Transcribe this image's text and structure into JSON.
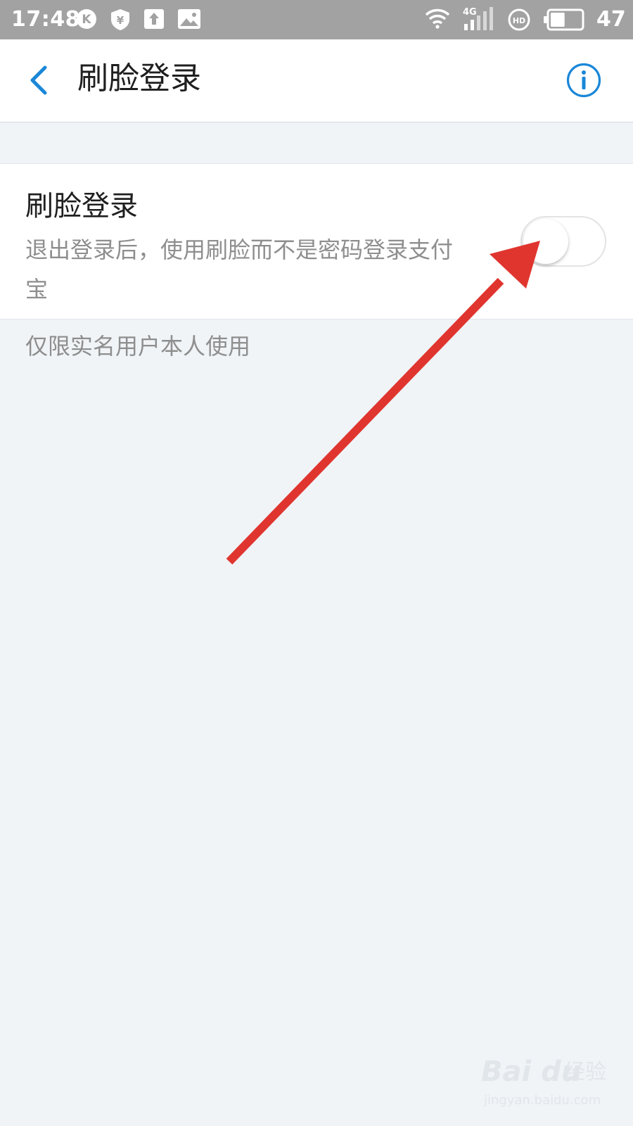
{
  "status_bar": {
    "time": "17:48",
    "left_icons": [
      "k-app-icon",
      "yuan-shield-icon",
      "upload-icon",
      "image-icon"
    ],
    "right_icons": [
      "wifi-icon",
      "signal-4g-icon",
      "hd-icon",
      "battery-icon"
    ],
    "network_label": "4G",
    "hd_label": "HD",
    "k_label": "K",
    "yuan_label": "¥",
    "battery_percent": "47",
    "battery_level": 0.47
  },
  "header": {
    "title": "刷脸登录",
    "back_icon": "chevron-left-icon",
    "info_icon": "info-circle-icon"
  },
  "setting": {
    "title": "刷脸登录",
    "description": "退出登录后，使用刷脸而不是密码登录支付宝",
    "toggle_on": false
  },
  "footnote": "仅限实名用户本人使用",
  "colors": {
    "accent": "#1a87d8",
    "status_bar": "#a2a2a2",
    "page_background": "#f0f4f7",
    "annotation_arrow": "#e0352f"
  },
  "watermark": {
    "brand": "Bai du",
    "cn": "经验",
    "url": "jingyan.baidu.com"
  }
}
